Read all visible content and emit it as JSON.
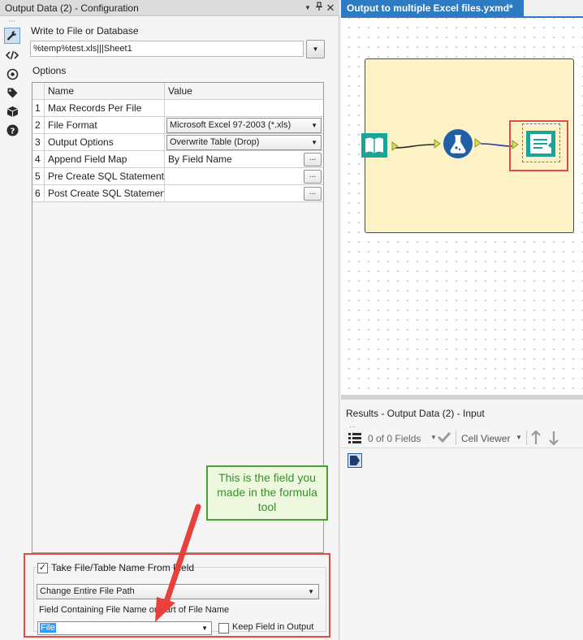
{
  "config_panel": {
    "title": "Output Data (2) - Configuration",
    "write_label": "Write to File or Database",
    "path_value": "%temp%test.xls|||Sheet1",
    "options_label": "Options",
    "grid": {
      "headers": [
        "Name",
        "Value"
      ],
      "rows": [
        {
          "index": "1",
          "name": "Max Records Per File",
          "value": ""
        },
        {
          "index": "2",
          "name": "File Format",
          "value": "Microsoft Excel 97-2003 (*.xls)"
        },
        {
          "index": "3",
          "name": "Output Options",
          "value": "Overwrite Table (Drop)"
        },
        {
          "index": "4",
          "name": "Append Field Map",
          "value": "By Field Name"
        },
        {
          "index": "5",
          "name": "Pre Create SQL Statement",
          "value": ""
        },
        {
          "index": "6",
          "name": "Post Create SQL Statement",
          "value": ""
        }
      ],
      "ellipsis": "..."
    },
    "filename_section": {
      "take_label": "Take File/Table Name From Field",
      "take_checked": true,
      "mode_value": "Change Entire File Path",
      "field_label": "Field Containing File Name or Part of File Name",
      "field_value": "File",
      "keep_label": "Keep Field in Output",
      "keep_checked": false
    },
    "callout": "This is the field you made in the formula tool"
  },
  "canvas": {
    "tab_title": "Output to multiple Excel files.yxmd*"
  },
  "results": {
    "title": "Results - Output Data (2) - Input",
    "fields_count": "0 of 0 Fields",
    "cell_viewer": "Cell Viewer"
  },
  "colors": {
    "accent_blue": "#2d7bc2",
    "highlight_red": "#e04b43",
    "callout_green": "#4e9f33",
    "tool_teal": "#1aa59a",
    "container_yellow": "#fdf1c6"
  }
}
